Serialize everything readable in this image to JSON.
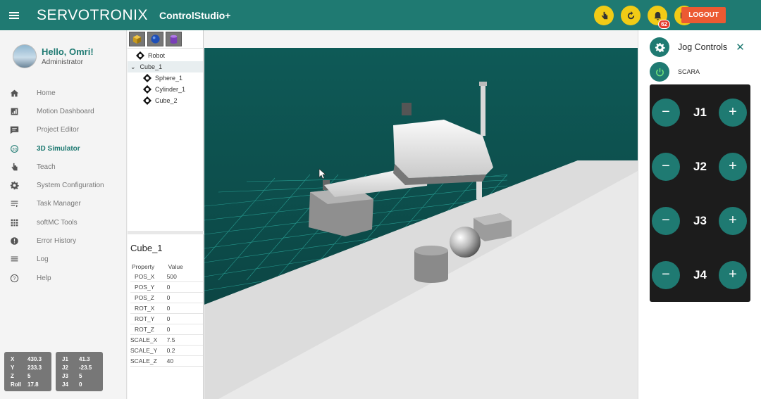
{
  "header": {
    "brand": "SERVOTRONIX",
    "product": "ControlStudio+",
    "notification_count": "62",
    "logout_label": "LOGOUT",
    "accent_color": "#1f7a72",
    "icons": [
      "teach-hand-icon",
      "refresh-icon",
      "bell-icon",
      "display-icon"
    ]
  },
  "user": {
    "greeting": "Hello, Omri!",
    "role": "Administrator"
  },
  "sidebar": {
    "items": [
      {
        "label": "Home",
        "icon": "home-icon"
      },
      {
        "label": "Motion Dashboard",
        "icon": "dashboard-icon"
      },
      {
        "label": "Project Editor",
        "icon": "editor-icon"
      },
      {
        "label": "3D Simulator",
        "icon": "3d-icon",
        "active": true
      },
      {
        "label": "Teach",
        "icon": "teach-icon"
      },
      {
        "label": "System Configuration",
        "icon": "gear-icon"
      },
      {
        "label": "Task Manager",
        "icon": "task-icon"
      },
      {
        "label": "softMC Tools",
        "icon": "grid-icon"
      },
      {
        "label": "Error History",
        "icon": "error-icon"
      },
      {
        "label": "Log",
        "icon": "log-icon"
      },
      {
        "label": "Help",
        "icon": "help-icon"
      }
    ]
  },
  "position_readout": [
    {
      "key": "X",
      "value": "430.3"
    },
    {
      "key": "Y",
      "value": "233.3"
    },
    {
      "key": "Z",
      "value": "5"
    },
    {
      "key": "Roll",
      "value": "17.8"
    }
  ],
  "joint_readout": [
    {
      "key": "J1",
      "value": "41.3"
    },
    {
      "key": "J2",
      "value": "-23.5"
    },
    {
      "key": "J3",
      "value": "5"
    },
    {
      "key": "J4",
      "value": "0"
    }
  ],
  "tree": {
    "items": [
      {
        "label": "Robot"
      },
      {
        "label": "Cube_1",
        "selected": true
      },
      {
        "label": "Sphere_1"
      },
      {
        "label": "Cylinder_1"
      },
      {
        "label": "Cube_2"
      }
    ]
  },
  "properties": {
    "title": "Cube_1",
    "col_property": "Property",
    "col_value": "Value",
    "rows": [
      {
        "name": "POS_X",
        "value": "500"
      },
      {
        "name": "POS_Y",
        "value": "0"
      },
      {
        "name": "POS_Z",
        "value": "0"
      },
      {
        "name": "ROT_X",
        "value": "0"
      },
      {
        "name": "ROT_Y",
        "value": "0"
      },
      {
        "name": "ROT_Z",
        "value": "0"
      },
      {
        "name": "SCALE_X",
        "value": "7.5"
      },
      {
        "name": "SCALE_Y",
        "value": "0.2"
      },
      {
        "name": "SCALE_Z",
        "value": "40"
      }
    ]
  },
  "jog": {
    "title": "Jog Controls",
    "robot": "SCARA",
    "joints": [
      "J1",
      "J2",
      "J3",
      "J4"
    ],
    "minus": "−",
    "plus": "+"
  }
}
